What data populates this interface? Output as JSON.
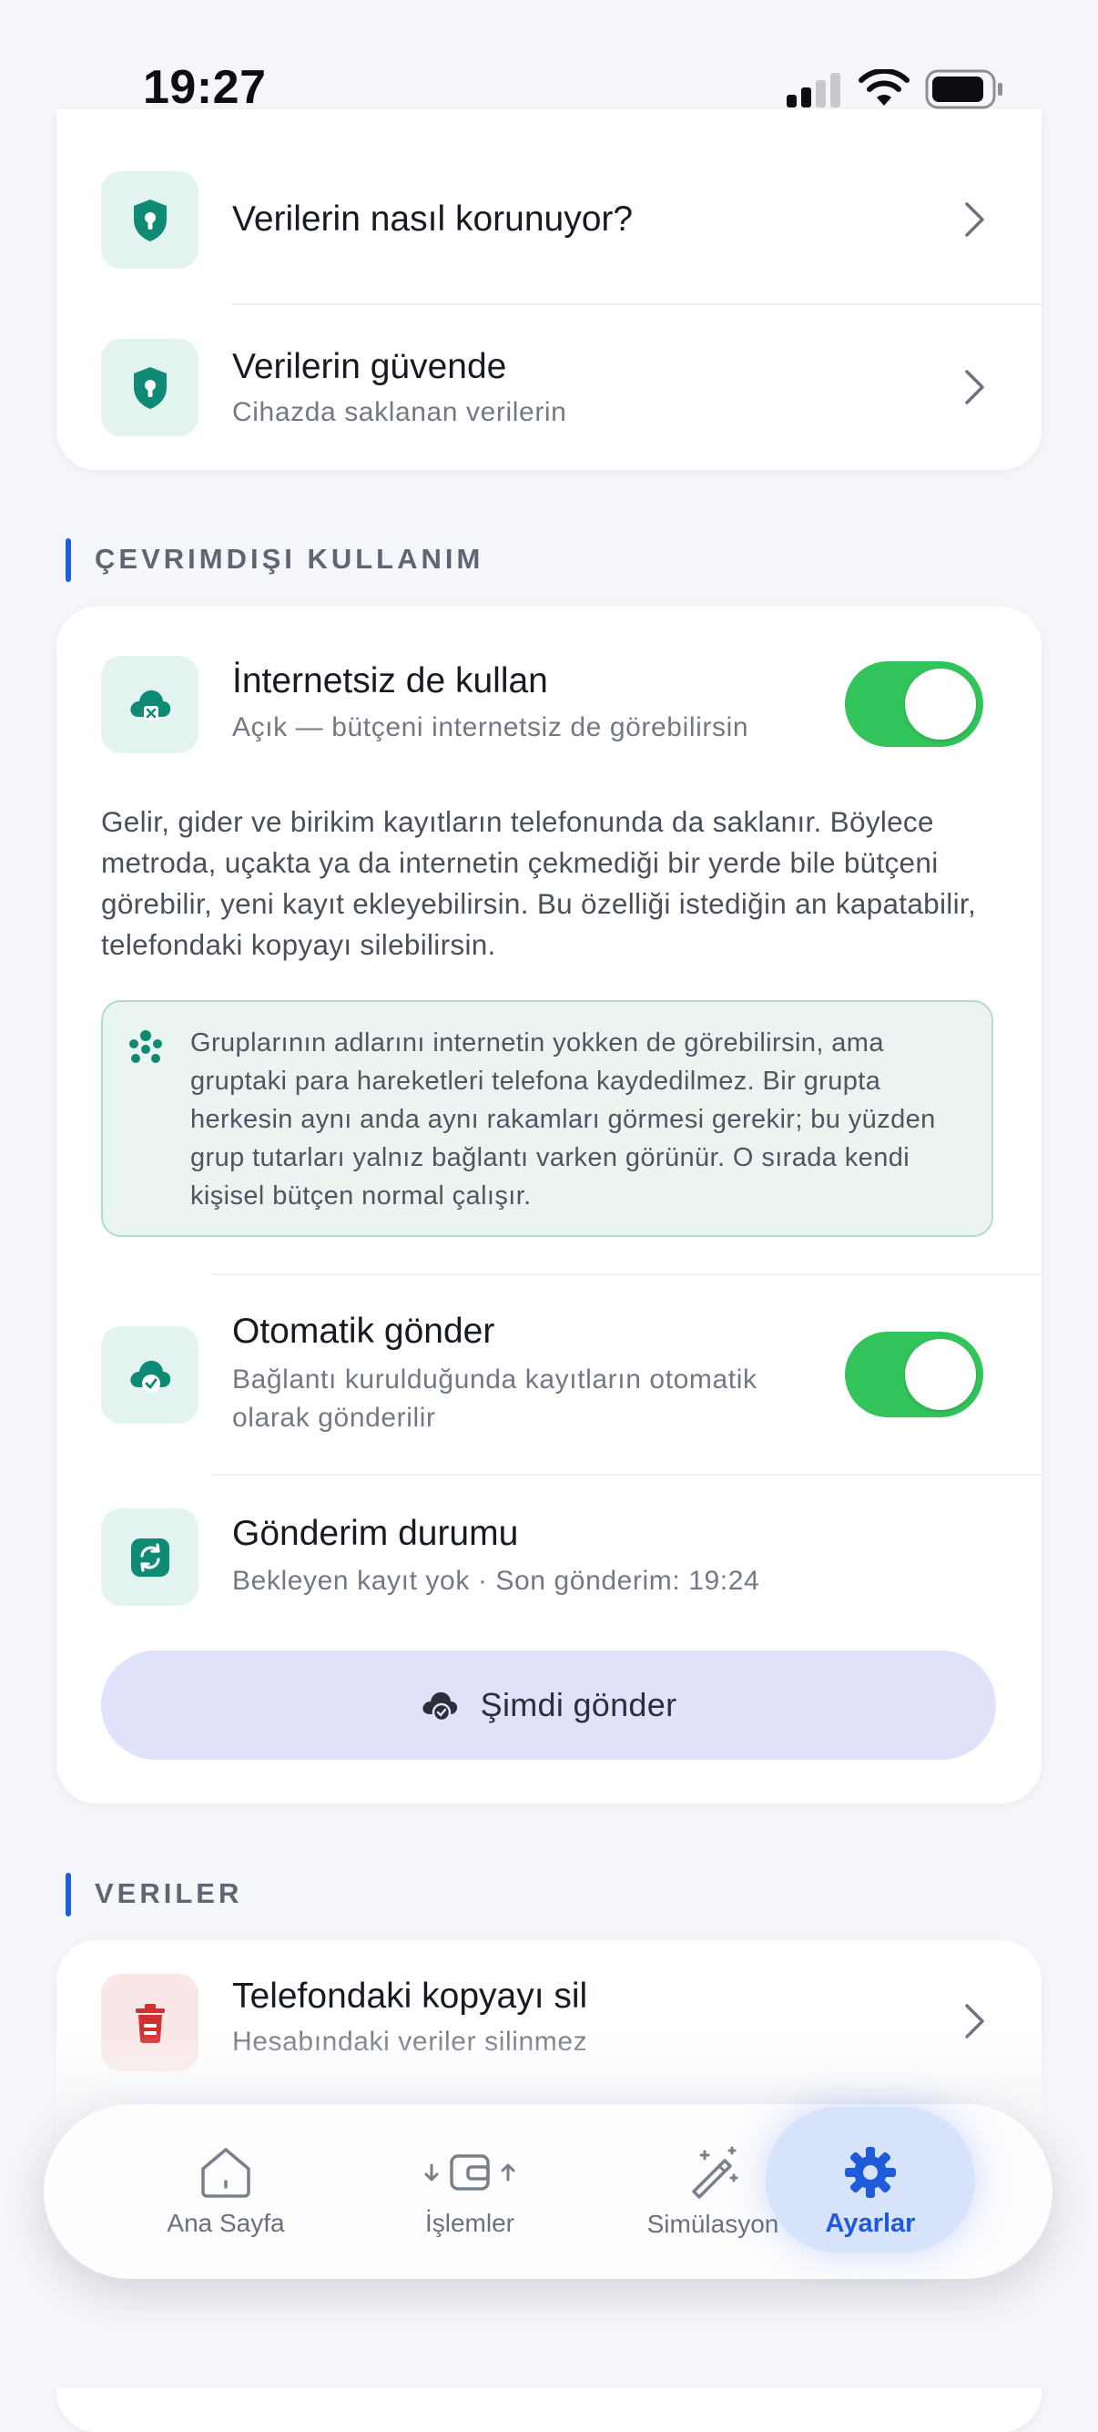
{
  "status_bar": {
    "time": "19:27"
  },
  "security_card": {
    "items": [
      {
        "title": "Verilerin nasıl korunuyor?",
        "icon": "shield-lock-icon"
      },
      {
        "title": "Verilerin güvende",
        "subtitle": "Cihazda saklanan verilerin",
        "icon": "shield-lock-icon"
      }
    ]
  },
  "offline_section": {
    "label": "ÇEVRIMDIŞI KULLANIM",
    "offline_toggle": {
      "title": "İnternetsiz de kullan",
      "subtitle": "Açık — bütçeni internetsiz de görebilirsin",
      "on": true
    },
    "description": "Gelir, gider ve birikim kayıtların telefonunda da saklanır. Böylece metroda, uçakta ya da internetin çekmediği bir yerde bile bütçeni görebilir, yeni kayıt ekleyebilirsin. Bu özelliği istediğin an kapatabilir, telefondaki kopyayı silebilirsin.",
    "info_text": "Gruplarının adlarını internetin yokken de görebilirsin, ama gruptaki para hareketleri telefona kaydedilmez. Bir grupta herkesin aynı anda aynı rakamları görmesi gerekir; bu yüzden grup tutarları yalnız bağlantı varken görünür. O sırada kendi kişisel bütçen normal çalışır.",
    "auto_send": {
      "title": "Otomatik gönder",
      "subtitle_line1": "Bağlantı kurulduğunda kayıtların otomatik",
      "subtitle_line2": "olarak gönderilir",
      "on": true
    },
    "send_status": {
      "title": "Gönderim durumu",
      "subtitle": "Bekleyen kayıt yok · Son gönderim: 19:24"
    },
    "send_now_label": "Şimdi gönder"
  },
  "data_section": {
    "label": "VERILER",
    "delete_copy": {
      "title": "Telefondaki kopyayı sil",
      "subtitle": "Hesabındaki veriler silinmez"
    }
  },
  "bottom_nav": {
    "items": [
      {
        "label": "Ana Sayfa",
        "icon": "home-icon"
      },
      {
        "label": "İşlemler",
        "icon": "wallet-transfer-icon"
      },
      {
        "label": "Simülasyon",
        "icon": "magic-wand-icon"
      },
      {
        "label": "Ayarlar",
        "icon": "gear-icon",
        "active": true
      }
    ]
  },
  "colors": {
    "accent_blue": "#1e5ed8",
    "toggle_green": "#33c35b",
    "teal_icon": "#0f8a74",
    "danger_red": "#d0302f"
  }
}
